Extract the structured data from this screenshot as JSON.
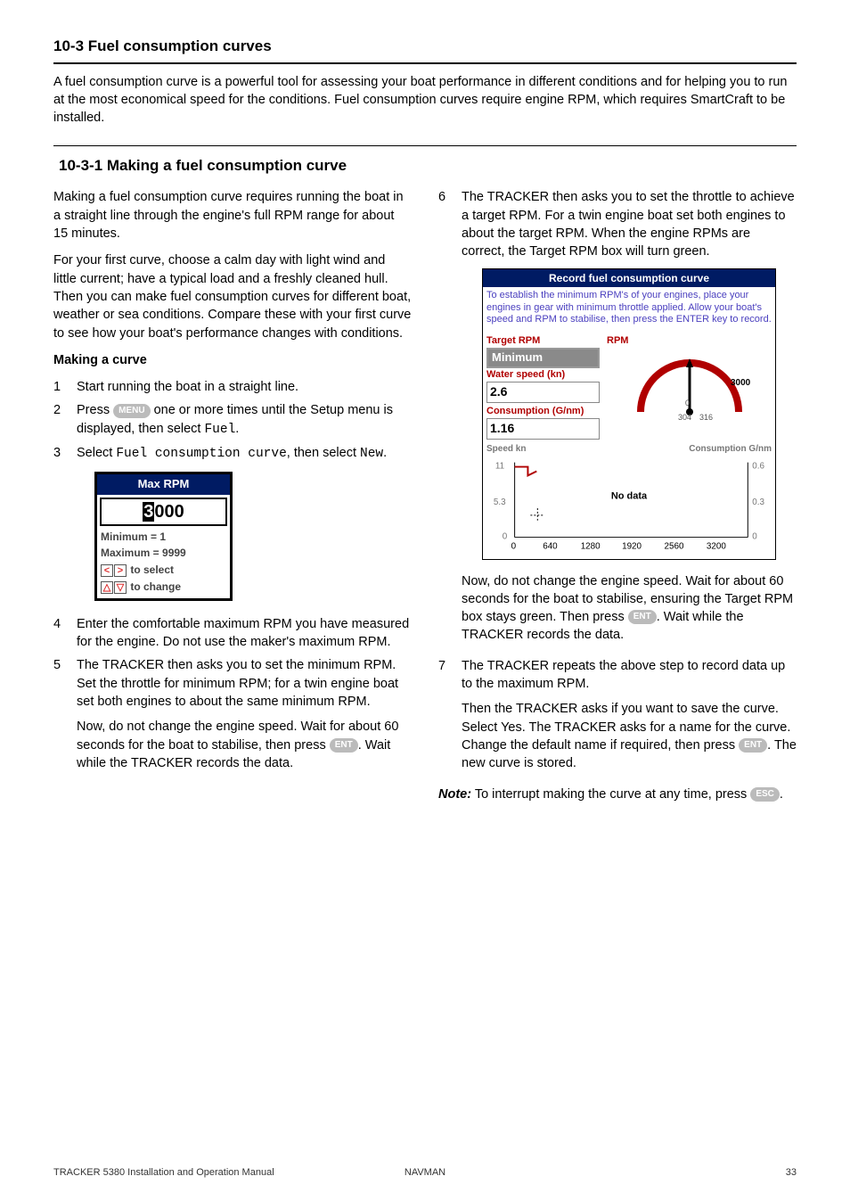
{
  "section_heading": "10-3 Fuel consumption curves",
  "intro_text": "A fuel consumption curve is a powerful tool for assessing your boat performance in different conditions and for helping you to run at the most economical speed for the conditions. Fuel consumption curves require engine RPM, which requires SmartCraft to be installed.",
  "sub_heading": "10-3-1 Making a fuel consumption curve",
  "left": {
    "p1": "Making a fuel consumption curve requires running the boat in a straight line through the engine's full RPM range for about 15 minutes.",
    "p2": "For your first curve, choose a calm day with light wind and little current; have a typical load and a freshly cleaned hull. Then you can make fuel consumption curves for different boat, weather or sea conditions. Compare these with your first curve to see how your boat's performance changes with conditions.",
    "making_head": "Making a curve",
    "step1": "Start running the boat in a straight line.",
    "step2_a": "Press ",
    "step2_key": "MENU",
    "step2_b": " one or more times until the Setup menu is displayed, then select ",
    "step2_mono": "Fuel",
    "step3_a": "Select ",
    "step3_mono1": "Fuel consumption curve",
    "step3_b": ", then select ",
    "step3_mono2": "New",
    "maxrpm": {
      "title": "Max RPM",
      "value_highlight": "3",
      "value_rest": "000",
      "min": "Minimum = 1",
      "max": "Maximum = 9999",
      "sel": " to select",
      "chg": " to change"
    },
    "step4": "Enter the comfortable maximum RPM you have measured for the engine. Do not use the maker's maximum RPM.",
    "step5_p1": "The TRACKER then asks you to set the minimum RPM. Set the throttle for minimum RPM; for a twin engine boat set both engines to about the same minimum RPM.",
    "step5_p2a": "Now, do not change the engine speed. Wait for about 60 seconds for the boat to stabilise, then press ",
    "step5_key": "ENT",
    "step5_p2b": ". Wait while the TRACKER records the data."
  },
  "right": {
    "step6": "The TRACKER then asks you to set the throttle to achieve a target RPM. For a twin engine boat set both engines to about the target RPM. When the engine RPMs are correct, the Target RPM box will turn green.",
    "rec": {
      "title": "Record fuel consumption curve",
      "info": "To establish the minimum RPM's of your engines, place your engines in gear with minimum throttle applied. Allow your boat's speed and RPM to stabilise, then press the ENTER key to record.",
      "target_label": "Target RPM",
      "rpm_label": "RPM",
      "min_box": "Minimum",
      "ws_label": "Water speed (kn)",
      "ws_value": "2.6",
      "cons_label": "Consumption (G/nm)",
      "cons_value": "1.16",
      "gauge_lo_tick": "0",
      "gauge_left": "304",
      "gauge_right": "316",
      "gauge_max": "3000",
      "speed_head": "Speed kn",
      "cons_head": "Consumption G/nm",
      "nodata": "No data"
    },
    "step6b_a": "Now, do not change the engine speed. Wait for about 60 seconds for the boat to stabilise, ensuring the Target RPM box stays green. Then press ",
    "step6b_key": "ENT",
    "step6b_b": ". Wait while the TRACKER records the data.",
    "step7_p1": "The TRACKER repeats the above step to record data up to the maximum RPM.",
    "step7_p2a": "Then the TRACKER asks if you want to save the curve. Select Yes. The TRACKER asks for a name for the curve. Change the default name if required, then press ",
    "step7_key": "ENT",
    "step7_p2b": ". The new curve is stored.",
    "note_label": "Note:",
    "note_a": " To interrupt making the curve at any time, press ",
    "note_key": "ESC",
    "note_b": "."
  },
  "chart_data": {
    "type": "line",
    "title": "",
    "x_ticks": [
      0,
      640,
      1280,
      1920,
      2560,
      3200
    ],
    "xlabel": "",
    "left_axis": {
      "label": "Speed kn",
      "ticks": [
        0,
        5.3,
        11
      ]
    },
    "right_axis": {
      "label": "Consumption G/nm",
      "ticks": [
        0,
        0.3,
        0.6
      ]
    },
    "series": [
      {
        "name": "Speed kn",
        "x": [
          0,
          200
        ],
        "y": [
          11,
          10
        ]
      },
      {
        "name": "Consumption G/nm",
        "x": [],
        "y": []
      }
    ],
    "annotation": "No data"
  },
  "footer": {
    "left": "TRACKER 5380  Installation and Operation Manual",
    "center": "NAVMAN",
    "right": "33"
  }
}
